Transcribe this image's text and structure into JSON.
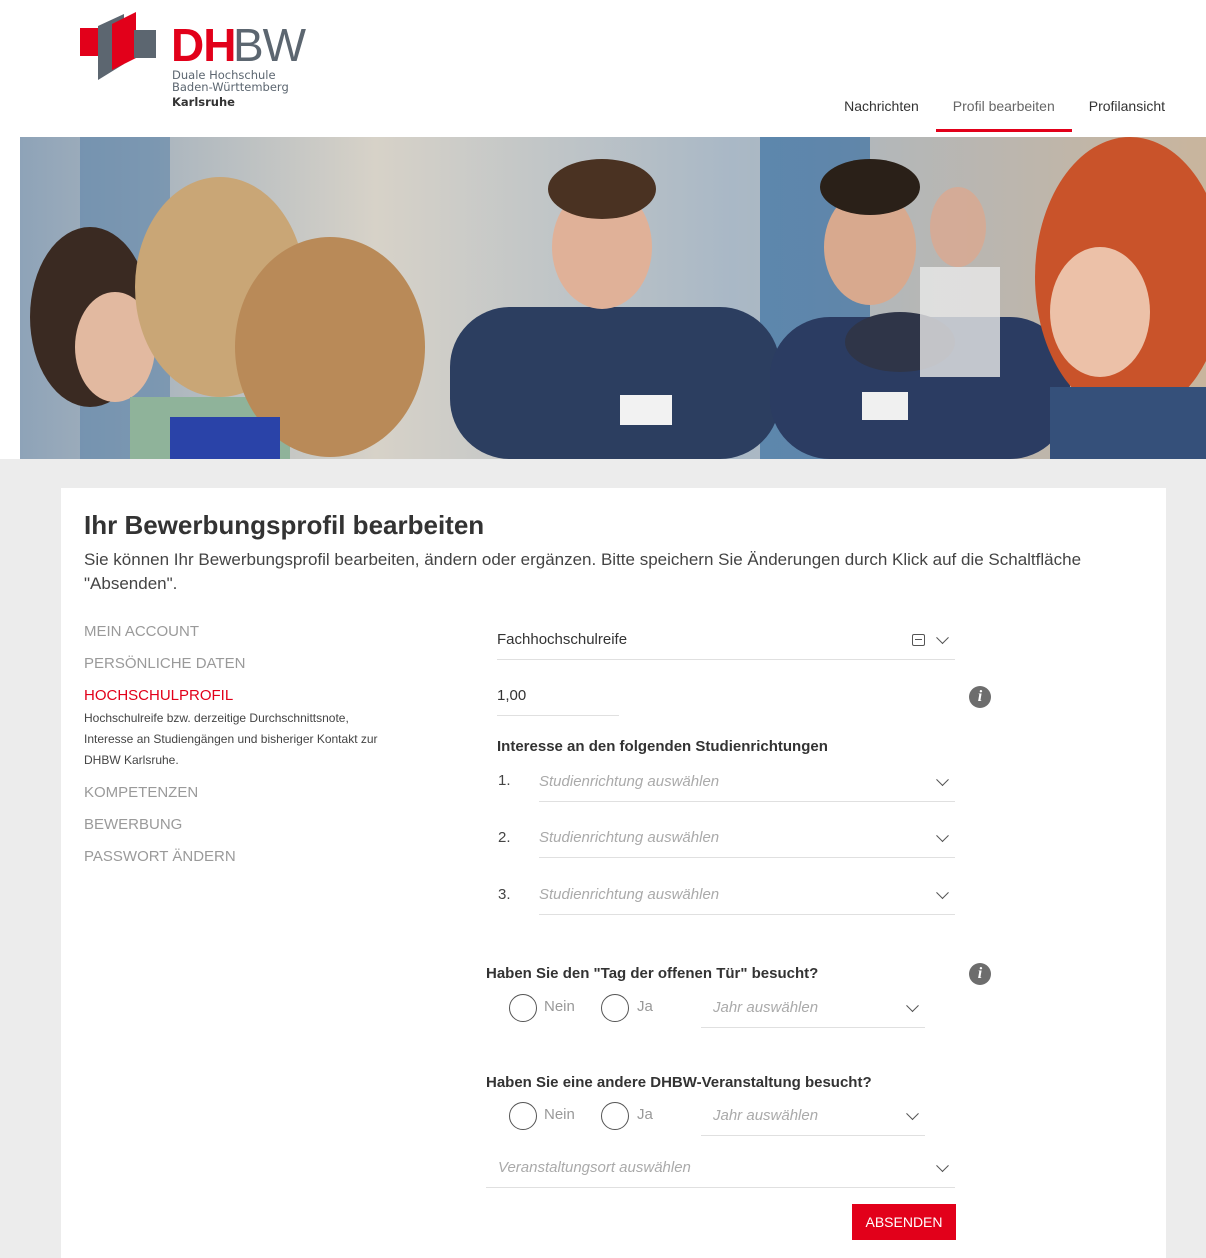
{
  "brand": {
    "logo_letters_red": "DH",
    "logo_letters_grey": "BW",
    "subtitle_line1": "Duale Hochschule",
    "subtitle_line2": "Baden-Württemberg",
    "subtitle_city": "Karlsruhe",
    "colors": {
      "red": "#e2001a",
      "grey": "#5c6670"
    }
  },
  "topnav": [
    {
      "label": "Nachrichten",
      "active": false
    },
    {
      "label": "Profil bearbeiten",
      "active": true
    },
    {
      "label": "Profilansicht",
      "active": false
    }
  ],
  "page": {
    "title": "Ihr Bewerbungsprofil bearbeiten",
    "intro": "Sie können Ihr Bewerbungsprofil bearbeiten, ändern oder ergänzen. Bitte speichern Sie Änderungen durch Klick auf die Schaltfläche \"Absenden\"."
  },
  "sidenav": {
    "items": [
      {
        "label": "MEIN ACCOUNT"
      },
      {
        "label": "PERSÖNLICHE DATEN"
      },
      {
        "label": "HOCHSCHULPROFIL",
        "active": true,
        "desc": "Hochschulreife bzw. derzeitige Durchschnittsnote, Interesse an Studiengängen und bisheriger Kontakt zur DHBW Karlsruhe."
      },
      {
        "label": "KOMPETENZEN"
      },
      {
        "label": "BEWERBUNG"
      },
      {
        "label": "PASSWORT ÄNDERN"
      }
    ]
  },
  "form": {
    "degree_value": "Fachhochschulreife",
    "grade_value": "1,00",
    "interest_heading": "Interesse an den folgenden Studienrichtungen",
    "interest_rows": [
      {
        "num": "1.",
        "placeholder": "Studienrichtung auswählen"
      },
      {
        "num": "2.",
        "placeholder": "Studienrichtung auswählen"
      },
      {
        "num": "3.",
        "placeholder": "Studienrichtung auswählen"
      }
    ],
    "open_day_question": "Haben Sie den \"Tag der offenen Tür\" besucht?",
    "other_event_question": "Haben Sie eine andere DHBW-Veranstaltung besucht?",
    "radio_no": "Nein",
    "radio_yes": "Ja",
    "year_placeholder": "Jahr auswählen",
    "location_placeholder": "Veranstaltungsort auswählen",
    "info_glyph": "i",
    "submit_label": "ABSENDEN"
  }
}
